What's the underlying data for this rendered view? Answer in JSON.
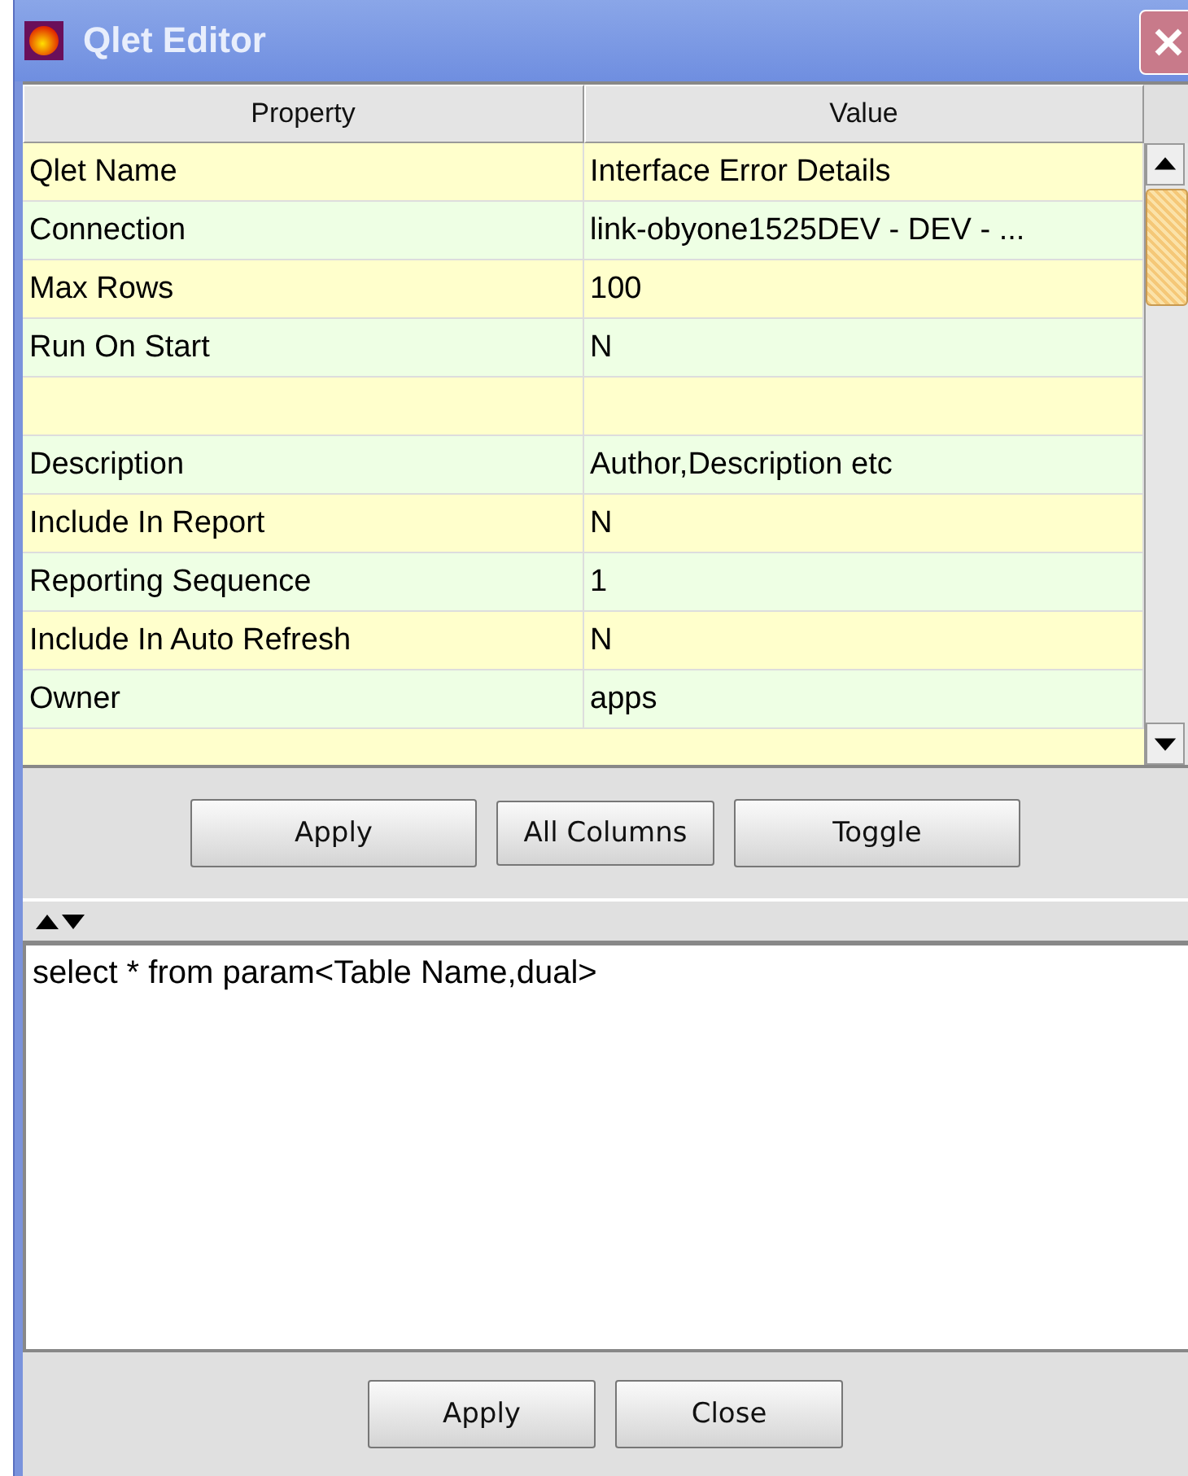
{
  "window": {
    "title": "Qlet Editor"
  },
  "table": {
    "columns": [
      "Property",
      "Value"
    ],
    "rows": [
      {
        "property": "Qlet Name",
        "value": "Interface Error Details"
      },
      {
        "property": "Connection",
        "value": "link-obyone1525DEV - DEV - ..."
      },
      {
        "property": "Max Rows",
        "value": "100"
      },
      {
        "property": "Run On Start",
        "value": "N"
      },
      {
        "property": "",
        "value": ""
      },
      {
        "property": "Description",
        "value": "Author,Description etc"
      },
      {
        "property": "Include In Report",
        "value": "N"
      },
      {
        "property": "Reporting Sequence",
        "value": "1"
      },
      {
        "property": "Include In Auto Refresh",
        "value": "N"
      },
      {
        "property": "Owner",
        "value": "apps"
      }
    ]
  },
  "table_buttons": [
    "Apply",
    "All Columns",
    "Toggle"
  ],
  "query_editor": {
    "value": "select * from param<Table Name,dual>"
  },
  "dialog_buttons": [
    "Apply",
    "Close"
  ]
}
